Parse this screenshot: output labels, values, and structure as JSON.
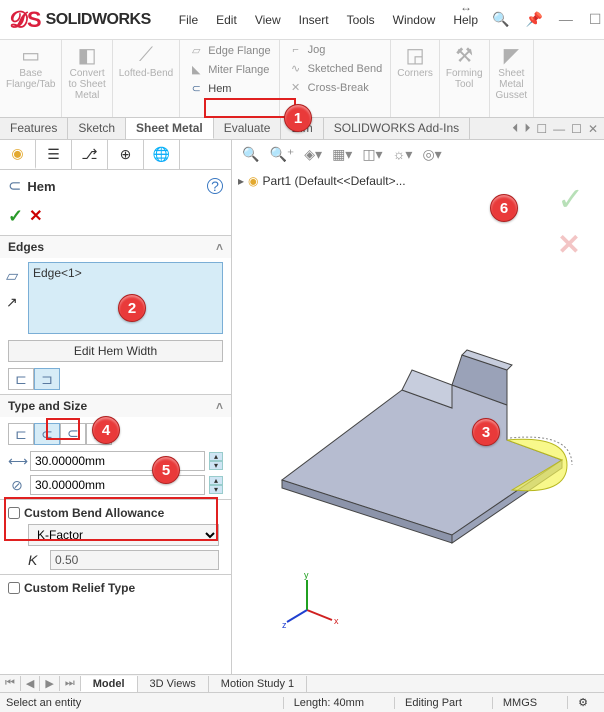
{
  "brand": "SOLIDWORKS",
  "menu": {
    "file": "File",
    "edit": "Edit",
    "view": "View",
    "insert": "Insert",
    "tools": "Tools",
    "window": "Window",
    "help": "Help"
  },
  "ribbon": {
    "base": "Base\nFlange/Tab",
    "convert": "Convert\nto Sheet\nMetal",
    "lofted": "Lofted-Bend",
    "edgeflange": "Edge Flange",
    "miter": "Miter Flange",
    "hem": "Hem",
    "jog": "Jog",
    "sketched": "Sketched Bend",
    "cross": "Cross-Break",
    "corners": "Corners",
    "forming": "Forming\nTool",
    "gusset": "Sheet\nMetal\nGusset"
  },
  "cmdtabs": {
    "features": "Features",
    "sketch": "Sketch",
    "sheetmetal": "Sheet Metal",
    "evaluate": "Evaluate",
    "dimxpert": "Dim",
    "addins": "SOLIDWORKS Add-Ins"
  },
  "feature": {
    "name": "Hem",
    "edges_header": "Edges",
    "edge1": "Edge<1>",
    "edit_width": "Edit Hem Width",
    "type_size": "Type and Size",
    "val1": "30.00000mm",
    "val2": "30.00000mm",
    "cba": "Custom Bend Allowance",
    "kfactor": "K-Factor",
    "kval": "0.50",
    "crt": "Custom Relief Type"
  },
  "tree": {
    "part": "Part1 (Default<<Default>..."
  },
  "bottomtabs": {
    "model": "Model",
    "views3d": "3D Views",
    "motion": "Motion Study 1"
  },
  "status": {
    "prompt": "Select an entity",
    "length": "Length: 40mm",
    "mode": "Editing Part",
    "units": "MMGS"
  }
}
